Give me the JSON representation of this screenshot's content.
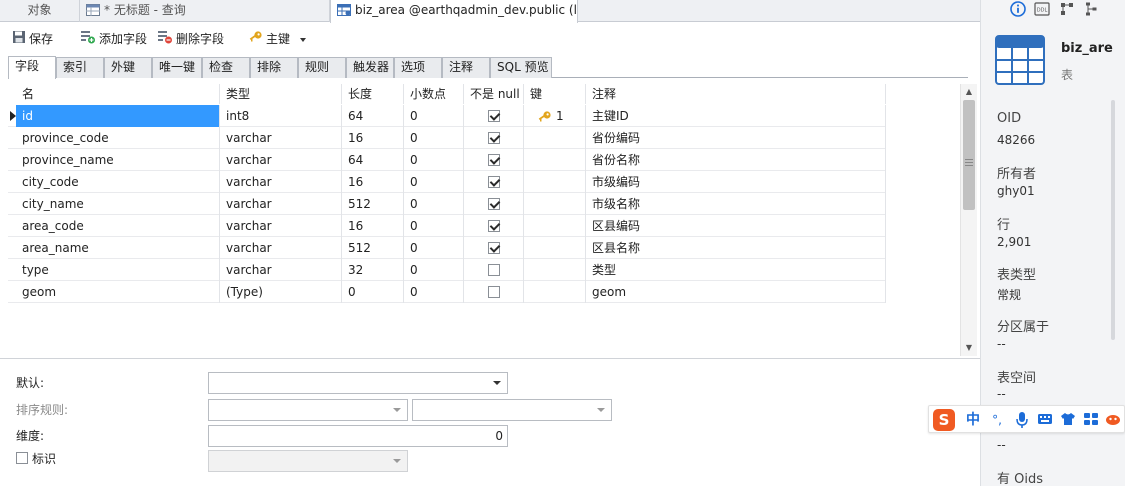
{
  "tabs": [
    {
      "label": "对象",
      "icon": "none"
    },
    {
      "label": "* 无标题 - 查询",
      "icon": "query-icon"
    },
    {
      "label": "biz_area @earthqadmin_dev.public (l...",
      "icon": "table-design-icon"
    }
  ],
  "toolbar": {
    "save": "保存",
    "add_field": "添加字段",
    "delete_field": "删除字段",
    "primary_key": "主键"
  },
  "subtabs": [
    "字段",
    "索引",
    "外键",
    "唯一键",
    "检查",
    "排除",
    "规则",
    "触发器",
    "选项",
    "注释",
    "SQL 预览"
  ],
  "grid": {
    "headers": [
      "名",
      "类型",
      "长度",
      "小数点",
      "不是 null",
      "键",
      "注释"
    ],
    "rows": [
      {
        "name": "id",
        "type": "int8",
        "length": "64",
        "decimals": "0",
        "not_null": true,
        "key": "1",
        "comment": "主键ID"
      },
      {
        "name": "province_code",
        "type": "varchar",
        "length": "16",
        "decimals": "0",
        "not_null": true,
        "key": "",
        "comment": "省份编码"
      },
      {
        "name": "province_name",
        "type": "varchar",
        "length": "64",
        "decimals": "0",
        "not_null": true,
        "key": "",
        "comment": "省份名称"
      },
      {
        "name": "city_code",
        "type": "varchar",
        "length": "16",
        "decimals": "0",
        "not_null": true,
        "key": "",
        "comment": "市级编码"
      },
      {
        "name": "city_name",
        "type": "varchar",
        "length": "512",
        "decimals": "0",
        "not_null": true,
        "key": "",
        "comment": "市级名称"
      },
      {
        "name": "area_code",
        "type": "varchar",
        "length": "16",
        "decimals": "0",
        "not_null": true,
        "key": "",
        "comment": "区县编码"
      },
      {
        "name": "area_name",
        "type": "varchar",
        "length": "512",
        "decimals": "0",
        "not_null": true,
        "key": "",
        "comment": "区县名称"
      },
      {
        "name": "type",
        "type": "varchar",
        "length": "32",
        "decimals": "0",
        "not_null": false,
        "key": "",
        "comment": "类型"
      },
      {
        "name": "geom",
        "type": "(Type)",
        "length": "0",
        "decimals": "0",
        "not_null": false,
        "key": "",
        "comment": "geom"
      }
    ]
  },
  "props": {
    "default_label": "默认:",
    "collation_label": "排序规则:",
    "dimension_label": "维度:",
    "dimension_value": "0",
    "identity_label": "标识"
  },
  "sidebar": {
    "object_name": "biz_are",
    "object_type": "表",
    "fields": [
      {
        "key": "OID",
        "value": "48266"
      },
      {
        "key": "所有者",
        "value": "ghy01"
      },
      {
        "key": "行",
        "value": "2,901"
      },
      {
        "key": "表类型",
        "value": "常规"
      },
      {
        "key": "分区属于",
        "value": "--"
      },
      {
        "key": "表空间",
        "value": "--"
      },
      {
        "key": "",
        "value": "--"
      },
      {
        "key": "有 Oids",
        "value": ""
      }
    ]
  },
  "ime": {
    "mode": "中",
    "punct": "°,"
  },
  "colors": {
    "selection": "#3399ff",
    "accent": "#1c6cd8",
    "ime_logo": "#f05a22"
  }
}
